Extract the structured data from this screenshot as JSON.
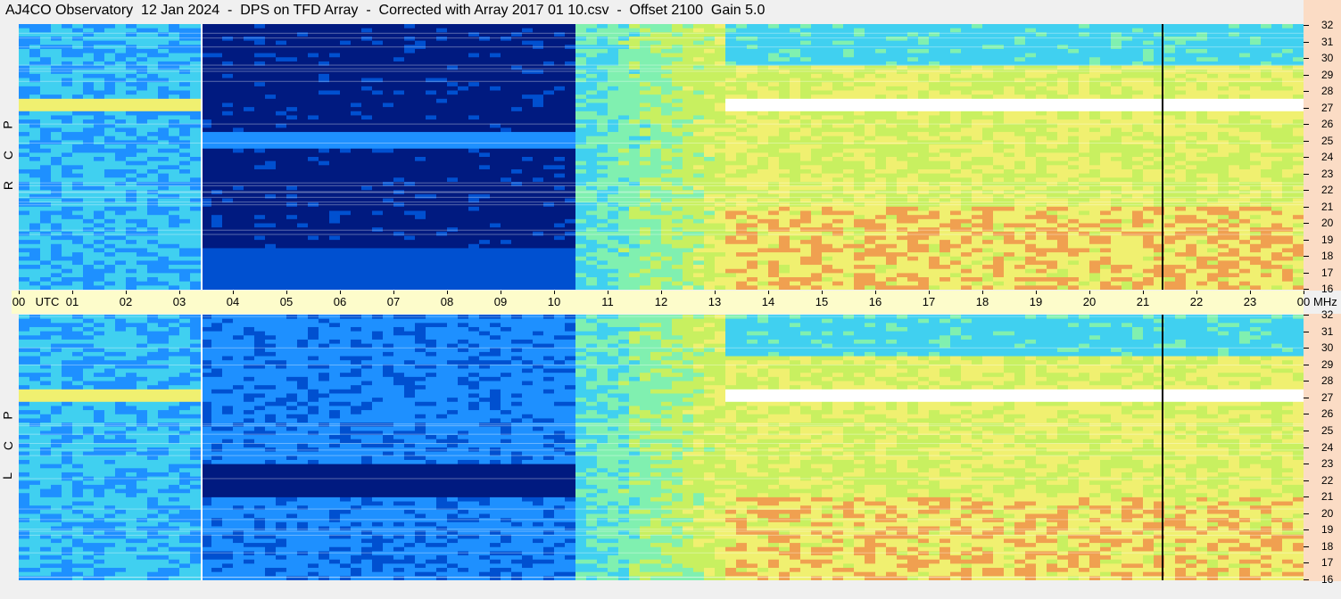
{
  "title": "AJ4CO Observatory  12 Jan 2024  -  DPS on TFD Array  -  Corrected with Array 2017 01 10.csv  -  Offset 2100  Gain 5.0",
  "chart_data": {
    "type": "heatmap",
    "title": "AJ4CO Observatory  12 Jan 2024  -  DPS on TFD Array  -  Corrected with Array 2017 01 10.csv  -  Offset 2100  Gain 5.0",
    "x_unit": "UTC",
    "x_ticks": [
      "00",
      "01",
      "02",
      "03",
      "04",
      "05",
      "06",
      "07",
      "08",
      "09",
      "10",
      "11",
      "12",
      "13",
      "14",
      "15",
      "16",
      "17",
      "18",
      "19",
      "20",
      "21",
      "22",
      "23",
      "00"
    ],
    "xlim": [
      0,
      24
    ],
    "y_unit": "MHz",
    "ylim": [
      16,
      32
    ],
    "y_ticks": [
      "32",
      "31",
      "30",
      "29",
      "28",
      "27",
      "26",
      "25",
      "24",
      "23",
      "22",
      "21",
      "20",
      "19",
      "18",
      "17",
      "16"
    ],
    "panels": [
      {
        "name": "RCP",
        "letters": [
          "P",
          "C",
          "R"
        ]
      },
      {
        "name": "LCP",
        "letters": [
          "P",
          "C",
          "L"
        ]
      }
    ],
    "colormap": [
      "#000020",
      "#001a80",
      "#0050d0",
      "#1e90ff",
      "#40d0f0",
      "#80f0b0",
      "#c8f060",
      "#f0f070",
      "#f0a050",
      "#f060a0",
      "#ffffff"
    ]
  },
  "axis": {
    "utc_label": "UTC",
    "mhz_label": "MHz"
  }
}
